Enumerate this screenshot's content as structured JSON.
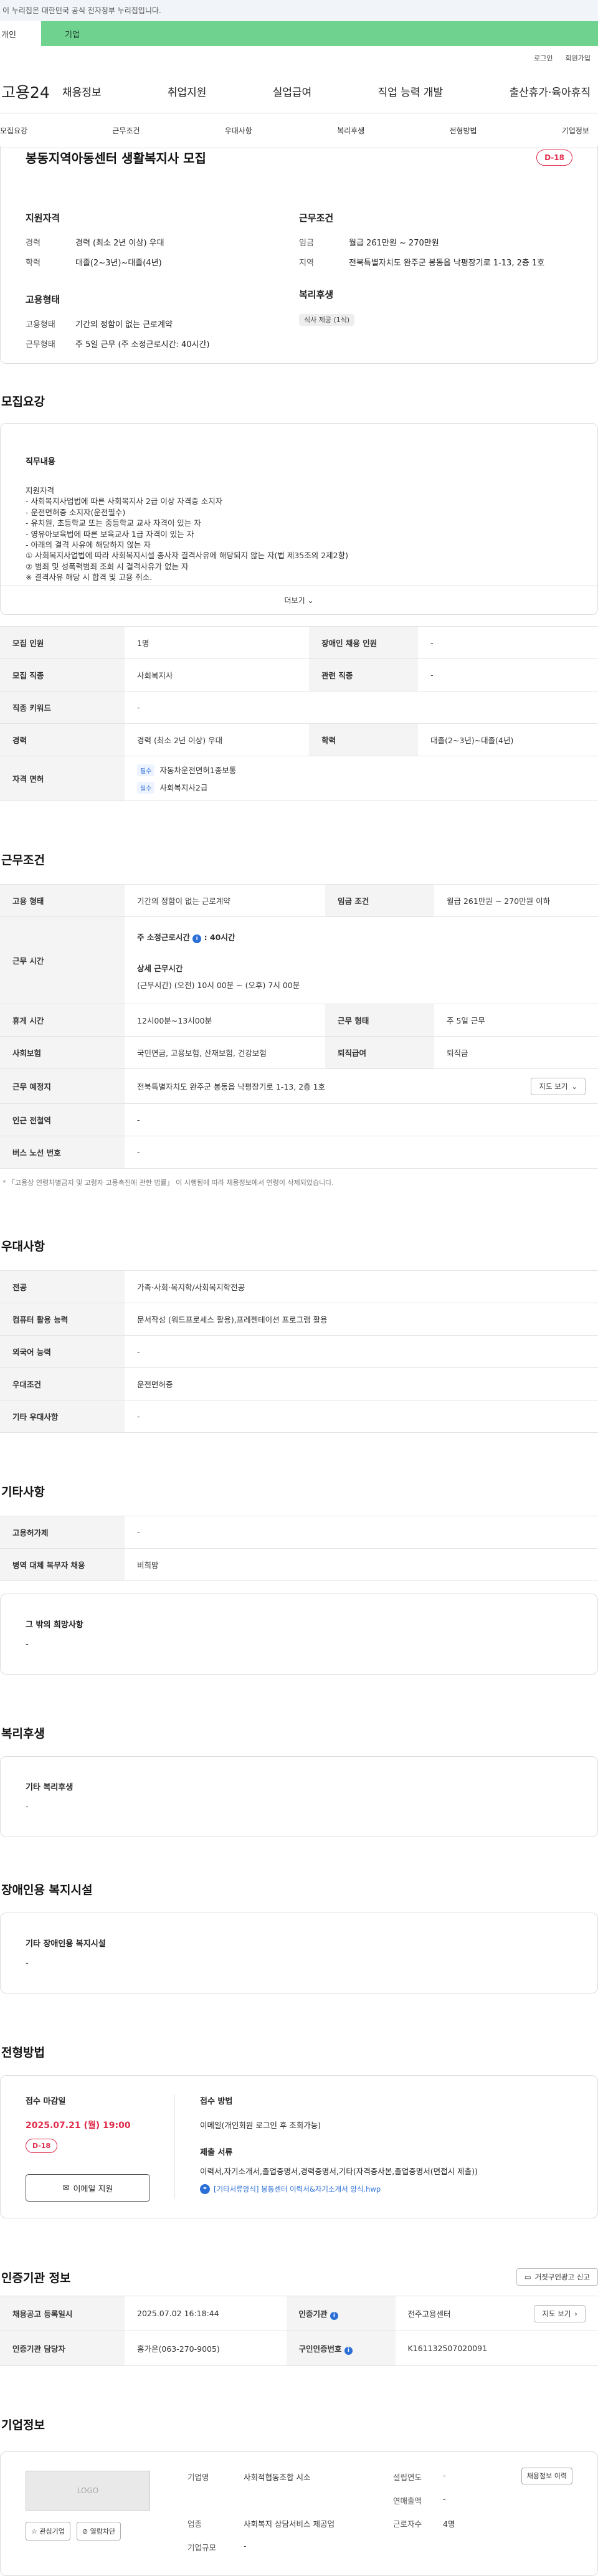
{
  "gov_bar": "이 누리집은 대한민국 공식 전자정부 누리집입니다.",
  "site_tabs": {
    "personal": "개인",
    "company": "기업"
  },
  "util": {
    "login": "로그인",
    "join": "회원가입"
  },
  "logo": "고용24",
  "gnb": [
    "채용정보",
    "취업지원",
    "실업급여",
    "직업 능력 개발",
    "출산휴가·육아휴직"
  ],
  "lnb": [
    "모집요강",
    "근무조건",
    "우대사항",
    "복리후생",
    "전형방법",
    "기업정보"
  ],
  "summary": {
    "title": "봉동지역아동센터 생활복지사 모집",
    "dday": "D-18",
    "qual_title": "지원자격",
    "qual": [
      {
        "k": "경력",
        "v": "경력 (최소 2년 이상) 우대"
      },
      {
        "k": "학력",
        "v": "대졸(2~3년)~대졸(4년)"
      }
    ],
    "cond_title": "근무조건",
    "cond": [
      {
        "k": "임금",
        "v": "월급 261만원 ~ 270만원"
      },
      {
        "k": "지역",
        "v": "전북특별자치도 완주군 봉동읍 낙평장기로 1-13, 2층 1호"
      }
    ],
    "emp_title": "고용형태",
    "emp": [
      {
        "k": "고용형태",
        "v": "기간의 정함이 없는 근로계약"
      },
      {
        "k": "근무형태",
        "v": "주 5일 근무 (주 소정근로시간: 40시간)"
      }
    ],
    "welfare_title": "복리후생",
    "welfare_badge": "식사 제공 (1식)"
  },
  "recruit": {
    "section_title": "모집요강",
    "duty_title": "직무내용",
    "duty_lines": [
      "지원자격",
      "- 사회복지사업법에 따른 사회복지사 2급 이상 자격증 소지자",
      "- 운전면허증 소지자(운전필수)",
      "- 유치원, 초등학교 또는 중등학교 교사 자격이 있는 자",
      "- 영유아보육법에 따른 보육교사 1급 자격이 있는 자",
      "- 아래의 결격 사유에 해당하지 않는 자",
      "① 사회복지사업법에 따라 사회복지시설 종사자 결격사유에 해당되지 않는 자(법 제35조의 2제2항)",
      "② 범죄 및 성폭력범죄 조회 시 결격사유가 없는 자",
      "※ 결격사유 해당 시 합격 및 고용 취소."
    ],
    "more": "더보기",
    "rows": [
      {
        "k1": "모집 인원",
        "v1": "1명",
        "k2": "장애인 채용 인원",
        "v2": "-"
      },
      {
        "k1": "모집 직종",
        "v1": "사회복지사",
        "k2": "관련 직종",
        "v2": "-"
      },
      {
        "k1": "직종 키워드",
        "v1": "-"
      },
      {
        "k1": "경력",
        "v1": "경력 (최소 2년 이상) 우대",
        "k2": "학력",
        "v2": "대졸(2~3년)~대졸(4년)"
      }
    ],
    "license_key": "자격 면허",
    "licenses": [
      {
        "badge": "필수",
        "name": "자동차운전면허1종보통"
      },
      {
        "badge": "필수",
        "name": "사회복지사2급"
      }
    ]
  },
  "work": {
    "section_title": "근무조건",
    "emp_type_k": "고용 형태",
    "emp_type_v": "기간의 정함이 없는 근로계약",
    "wage_k": "임금 조건",
    "wage_v": "월급 261만원 ~ 270만원 이하",
    "hours_k": "근무 시간",
    "hours_title": "주 소정근로시간",
    "hours_value": "40시간",
    "detail_title": "상세 근무시간",
    "detail_value": "(근무시간) (오전) 10시 00분 ~ (오후) 7시 00분",
    "rest_k": "휴게 시간",
    "rest_v": "12시00분~13시00분",
    "form_k": "근무 형태",
    "form_v": "주 5일 근무",
    "ins_k": "사회보험",
    "ins_v": "국민연금, 고용보험, 산재보험, 건강보험",
    "ret_k": "퇴직급여",
    "ret_v": "퇴직금",
    "place_k": "근무 예정지",
    "place_v": "전북특별자치도 완주군 봉동읍 낙평장기로 1-13, 2층 1호",
    "map_btn": "지도 보기",
    "subway_k": "인근 전철역",
    "subway_v": "-",
    "bus_k": "버스 노선 번호",
    "bus_v": "-",
    "note": "* 「고용상 연령차별금지 및 고령자 고용촉진에 관한 법률」 이 시행됨에 따라 채용정보에서 연령이 삭제되었습니다."
  },
  "pref": {
    "section_title": "우대사항",
    "rows": [
      {
        "k": "전공",
        "v": "가족·사회·복지학/사회복지학전공"
      },
      {
        "k": "컴퓨터 활용 능력",
        "v": "문서작성 (워드프로세스 활용),프레젠테이션 프로그램 활용"
      },
      {
        "k": "외국어 능력",
        "v": "-"
      },
      {
        "k": "우대조건",
        "v": "운전면허증"
      },
      {
        "k": "기타 우대사항",
        "v": "-"
      }
    ]
  },
  "etc": {
    "section_title": "기타사항",
    "rows": [
      {
        "k": "고용허가제",
        "v": "-"
      },
      {
        "k": "병역 대체 복무자 채용",
        "v": "비희망"
      }
    ],
    "box_title": "그 밖의 희망사항",
    "box_val": "-"
  },
  "benefits": {
    "section_title": "복리후생",
    "box_title": "기타 복리후생",
    "box_val": "-"
  },
  "disabled": {
    "section_title": "장애인용 복지시설",
    "box_title": "기타 장애인용 복지시설",
    "box_val": "-"
  },
  "process": {
    "section_title": "전형방법",
    "deadline_label": "접수 마감일",
    "deadline": "2025.07.21 (월) 19:00",
    "dday": "D-18",
    "email_btn": "이메일 지원",
    "method_label": "접수 방법",
    "method_val": "이메일(개인회원 로그인 후 조회가능)",
    "docs_label": "제출 서류",
    "docs_val": "이력서,자기소개서,졸업증명서,경력증명서,기타(자격증사본,졸업증명서(면접시 제출))",
    "file_link": "[기타서류양식] 봉동센터 이력서&자기소개서 양식.hwp"
  },
  "cert": {
    "section_title": "인증기관 정보",
    "report_btn": "거짓구인광고 신고",
    "reg_k": "채용공고 등록일시",
    "reg_v": "2025.07.02 16:18:44",
    "agency_k": "인증기관",
    "agency_v": "전주고용센터",
    "map_btn": "지도 보기",
    "manager_k": "인증기관 담당자",
    "manager_v": "홍가은(063-270-9005)",
    "num_k": "구인인증번호",
    "num_v": "K161132507020091"
  },
  "company": {
    "section_title": "기업정보",
    "logo_text": "LOGO",
    "fav_btn": "관심기업",
    "block_btn": "열람차단",
    "history_btn": "채용정보 이력",
    "name_k": "기업명",
    "name_v": "사회적협동조합 시소",
    "founded_k": "설립연도",
    "founded_v": "-",
    "sales_k": "연매출액",
    "sales_v": "-",
    "biz_k": "업종",
    "biz_v": "사회복지 상담서비스 제공업",
    "emp_k": "근로자수",
    "emp_v": "4명",
    "size_k": "기업규모",
    "size_v": "-"
  }
}
